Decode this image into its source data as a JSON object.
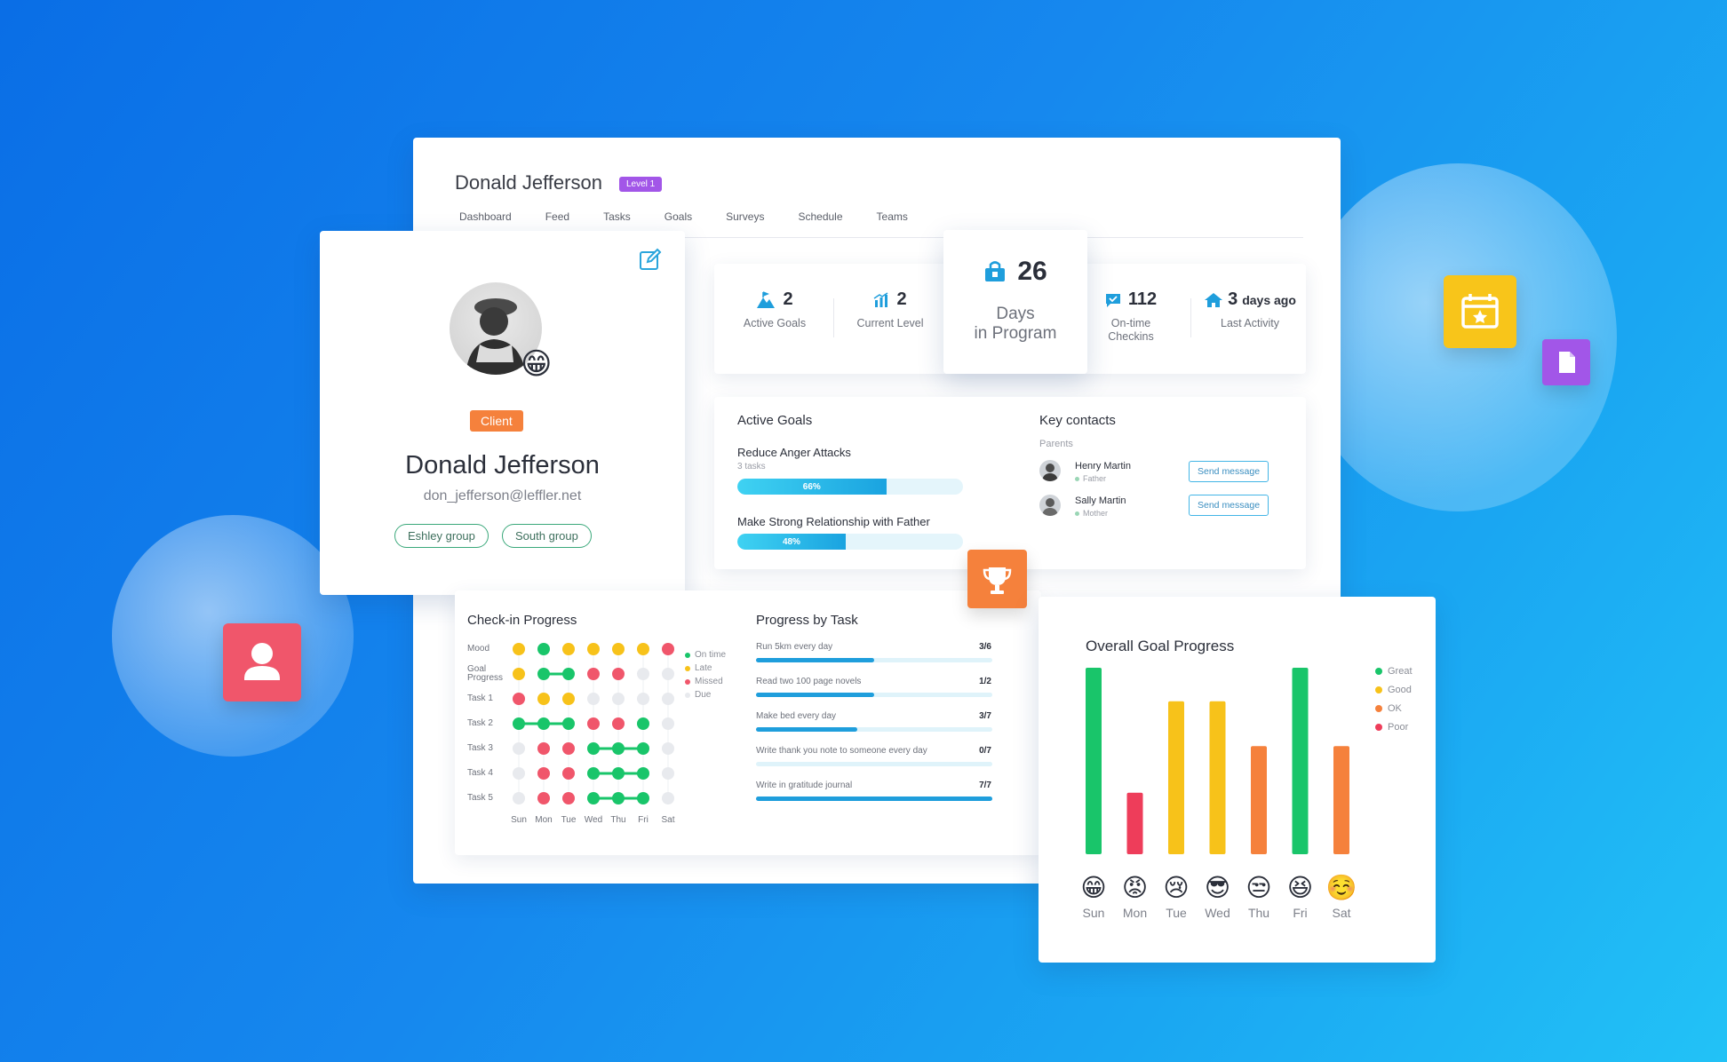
{
  "header": {
    "title": "Donald Jefferson",
    "level_badge": "Level 1",
    "tabs": [
      "Dashboard",
      "Feed",
      "Tasks",
      "Goals",
      "Surveys",
      "Schedule",
      "Teams"
    ]
  },
  "profile": {
    "badge": "Client",
    "name": "Donald Jefferson",
    "email": "don_jefferson@leffler.net",
    "groups": [
      "Eshley group",
      "South group"
    ]
  },
  "stats": {
    "active_goals": {
      "value": "2",
      "label": "Active Goals"
    },
    "current_level": {
      "value": "2",
      "label": "Current Level"
    },
    "days_in_program": {
      "value": "26",
      "label_1": "Days",
      "label_2": "in Program"
    },
    "ontime_checkins": {
      "value": "112",
      "label_1": "On-time",
      "label_2": "Checkins"
    },
    "last_activity": {
      "value": "3",
      "unit": "days ago",
      "label": "Last Activity"
    }
  },
  "active_goals": {
    "title": "Active Goals",
    "goals": [
      {
        "title": "Reduce Anger Attacks",
        "sub": "3 tasks",
        "percent_label": "66%",
        "fraction": 0.66
      },
      {
        "title": "Make Strong Relationship with Father",
        "percent_label": "48%",
        "fraction": 0.48
      }
    ]
  },
  "key_contacts": {
    "title": "Key contacts",
    "group_label": "Parents",
    "contacts": [
      {
        "name": "Henry Martin",
        "relation": "Father",
        "button": "Send message"
      },
      {
        "name": "Sally Martin",
        "relation": "Mother",
        "button": "Send message"
      }
    ]
  },
  "checkin": {
    "title": "Check-in Progress",
    "rows": [
      "Mood",
      "Goal Progress",
      "Task 1",
      "Task 2",
      "Task 3",
      "Task 4",
      "Task 5"
    ],
    "days": [
      "Sun",
      "Mon",
      "Tue",
      "Wed",
      "Thu",
      "Fri",
      "Sat"
    ],
    "legend": [
      {
        "label": "On time",
        "color": "#19c56a"
      },
      {
        "label": "Late",
        "color": "#f7c21a"
      },
      {
        "label": "Missed",
        "color": "#f0566b"
      },
      {
        "label": "Due",
        "color": "#e8eaee"
      }
    ],
    "grid": [
      [
        "late",
        "ontime",
        "late",
        "late",
        "late",
        "late",
        "missed"
      ],
      [
        "late",
        "ontime",
        "ontime",
        "missed",
        "missed",
        "due",
        "due"
      ],
      [
        "missed",
        "late",
        "late",
        "due",
        "due",
        "due",
        "due"
      ],
      [
        "ontime",
        "ontime",
        "ontime",
        "missed",
        "missed",
        "ontime",
        "due"
      ],
      [
        "due",
        "missed",
        "missed",
        "ontime",
        "ontime",
        "ontime",
        "due"
      ],
      [
        "due",
        "missed",
        "missed",
        "ontime",
        "ontime",
        "ontime",
        "due"
      ],
      [
        "due",
        "missed",
        "missed",
        "ontime",
        "ontime",
        "ontime",
        "due"
      ]
    ]
  },
  "progress_by_task": {
    "title": "Progress by Task",
    "tasks": [
      {
        "name": "Run 5km every day",
        "value": "3/6",
        "fraction": 0.5
      },
      {
        "name": "Read two 100 page novels",
        "value": "1/2",
        "fraction": 0.5
      },
      {
        "name": "Make bed every day",
        "value": "3/7",
        "fraction": 0.43
      },
      {
        "name": "Write thank you note to someone every day",
        "value": "0/7",
        "fraction": 0.0
      },
      {
        "name": "Write in gratitude journal",
        "value": "7/7",
        "fraction": 1.0
      }
    ]
  },
  "chart_data": {
    "type": "bar",
    "title": "Overall Goal Progress",
    "categories": [
      "Sun",
      "Mon",
      "Tue",
      "Wed",
      "Thu",
      "Fri",
      "Sat"
    ],
    "emojis": [
      "😁",
      "😡",
      "😢",
      "😎",
      "😒",
      "😆",
      "☺️"
    ],
    "values": [
      100,
      33,
      82,
      82,
      58,
      100,
      58
    ],
    "ratings": [
      "Great",
      "Poor",
      "Good",
      "Good",
      "OK",
      "Great",
      "OK"
    ],
    "ylim": [
      0,
      100
    ],
    "legend": [
      {
        "label": "Great",
        "color": "#19c56a"
      },
      {
        "label": "Good",
        "color": "#f7c21a"
      },
      {
        "label": "OK",
        "color": "#f5813c"
      },
      {
        "label": "Poor",
        "color": "#ee3d5a"
      }
    ],
    "legend_position": "top-right",
    "grid": false
  },
  "colors": {
    "accent": "#1aa3e0",
    "client_badge": "#f5813c",
    "level_badge": "#a256e8",
    "trophy": "#f5813c",
    "calendar": "#f8c51a",
    "document": "#a256e8",
    "user_tile": "#f0566b"
  }
}
